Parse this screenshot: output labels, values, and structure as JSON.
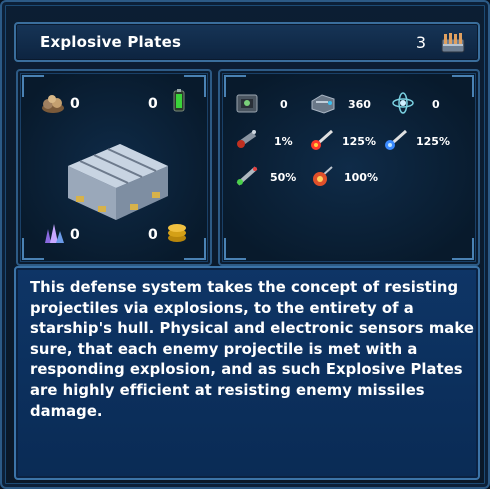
{
  "title": {
    "name": "Explosive Plates",
    "count": "3",
    "icon": "armor-rack-icon"
  },
  "resources": [
    {
      "key": "ore",
      "icon": "ore-pile-icon",
      "value": "0"
    },
    {
      "key": "energy",
      "icon": "energy-cell-icon",
      "value": "0"
    },
    {
      "key": "crystal",
      "icon": "crystal-cluster-icon",
      "value": "0"
    },
    {
      "key": "gold",
      "icon": "gold-coins-icon",
      "value": "0"
    }
  ],
  "stats": [
    {
      "key": "ammo",
      "icon": "ammo-box-icon",
      "value": "0"
    },
    {
      "key": "hull",
      "icon": "hull-armor-icon",
      "value": "360"
    },
    {
      "key": "shield",
      "icon": "shield-atom-icon",
      "value": "0"
    },
    {
      "key": "physical",
      "icon": "gatling-icon",
      "value": "1%"
    },
    {
      "key": "missile-red",
      "icon": "red-missile-icon",
      "value": "125%"
    },
    {
      "key": "missile-blue",
      "icon": "blue-missile-icon",
      "value": "125%"
    },
    {
      "key": "torpedo",
      "icon": "torpedo-icon",
      "value": "50%"
    },
    {
      "key": "bomb",
      "icon": "bomb-icon",
      "value": "100%"
    }
  ],
  "description": "This defense system takes the concept of resisting projectiles via explosions, to the entirety of a starship's hull. Physical and electronic sensors make sure, that each enemy projectile is met with a responding explosion, and as such Explosive Plates are highly efficient at resisting enemy missiles damage.",
  "colors": {
    "frame": "#2c5a86",
    "description_bg": "#0c3060",
    "text": "#ffffff"
  }
}
